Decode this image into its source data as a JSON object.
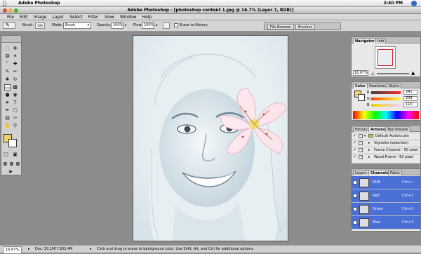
{
  "menubar": {
    "app": "Adobe Photoshop",
    "clock": "2:40 PM"
  },
  "window": {
    "title": "Adobe Photoshop - [photoshop content 1.jpg @ 16.7% (Layer 7, RGB)]"
  },
  "menu": [
    "File",
    "Edit",
    "Image",
    "Layer",
    "Select",
    "Filter",
    "View",
    "Window",
    "Help"
  ],
  "options": {
    "brush_label": "Brush:",
    "brush_size": "100",
    "mode_label": "Mode:",
    "mode_value": "Brush",
    "opacity_label": "Opacity:",
    "opacity_value": "100%",
    "flow_label": "Flow:",
    "flow_value": "100%",
    "erase_label": "Erase to History"
  },
  "palette_well": {
    "tabs": [
      "File Browser",
      "Brushes"
    ]
  },
  "navigator": {
    "tabs": [
      "Navigator",
      "Info"
    ],
    "zoom": "16.67%"
  },
  "color": {
    "tabs": [
      "Color",
      "Swatches",
      "Styles"
    ],
    "r": "241",
    "g": "209",
    "b": "110",
    "r_label": "R",
    "g_label": "G",
    "b_label": "B",
    "fg": "#f1d16e"
  },
  "actions": {
    "tabs": [
      "History",
      "Actions",
      "Tool Presets"
    ],
    "items": [
      "Default Actions.atn",
      "Vignette (selection)",
      "Frame Channel - 50 pixel",
      "Wood Frame - 50 pixel"
    ]
  },
  "channels": {
    "tabs": [
      "Layers",
      "Channels",
      "Paths"
    ],
    "rows": [
      {
        "name": "RGB",
        "key": "Ctrl+~"
      },
      {
        "name": "Red",
        "key": "Ctrl+1"
      },
      {
        "name": "Green",
        "key": "Ctrl+2"
      },
      {
        "name": "Blue",
        "key": "Ctrl+3"
      }
    ]
  },
  "status": {
    "zoom": "16.67%",
    "doc": "Doc: 30.1M/7.802.4M",
    "hint": "Click and drag to erase to background color. Use Shift, Alt, and Ctrl for additional options."
  }
}
